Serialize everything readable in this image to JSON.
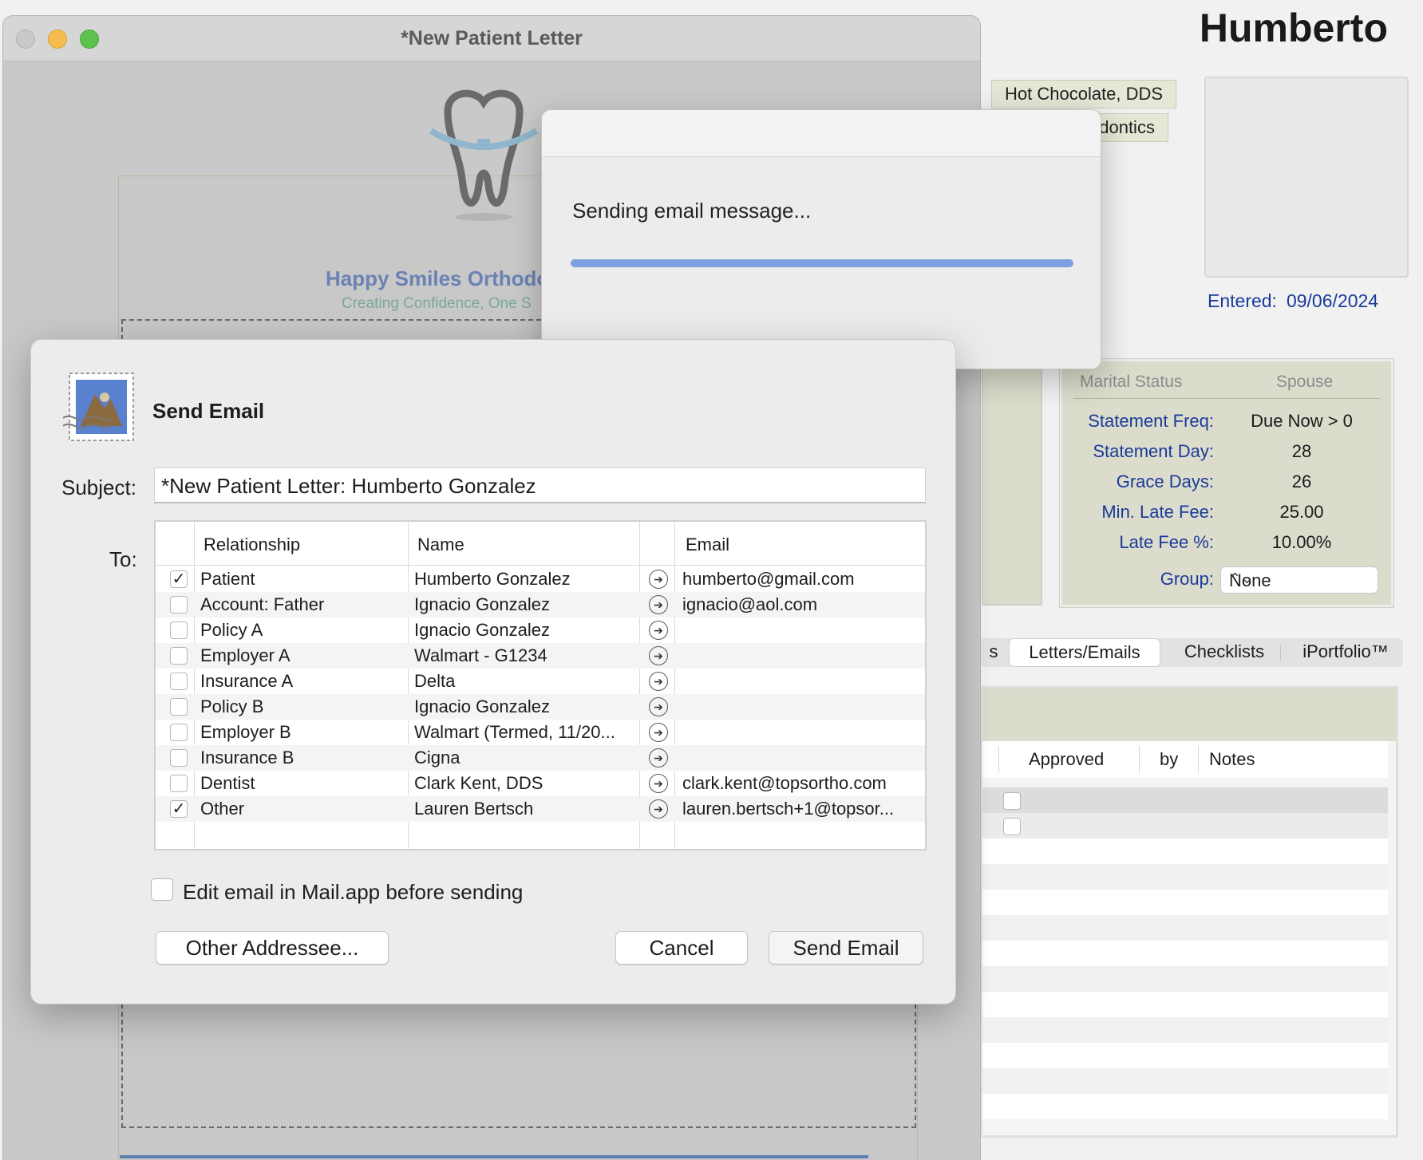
{
  "patient_window": {
    "patient_first_name": "Humberto",
    "doctor": "Hot Chocolate, DDS",
    "practice_type_partial": "odontics",
    "entered_label": "Entered:",
    "entered_date": "09/06/2024",
    "billing": {
      "marital_status_label": "Marital Status",
      "spouse_label": "Spouse",
      "rows": [
        {
          "label": "Statement Freq:",
          "value": "Due Now > 0"
        },
        {
          "label": "Statement Day:",
          "value": "28"
        },
        {
          "label": "Grace Days:",
          "value": "26"
        },
        {
          "label": "Min. Late Fee:",
          "value": "25.00"
        },
        {
          "label": "Late Fee %:",
          "value": "10.00%"
        }
      ],
      "group_label": "Group:",
      "group_value": "None"
    },
    "tabs": [
      {
        "label": "s"
      },
      {
        "label": "Letters/Emails",
        "active": true
      },
      {
        "label": "Checklists"
      },
      {
        "label": "iPortfolio™"
      }
    ],
    "list_columns": {
      "approved": "Approved",
      "by": "by",
      "notes": "Notes"
    }
  },
  "letter_window": {
    "title": "*New Patient Letter",
    "practice_name": "Happy Smiles Orthodo",
    "practice_tagline": "Creating Confidence, One S"
  },
  "progress_dialog": {
    "message": "Sending email message...",
    "progress": 1.0
  },
  "send_email": {
    "title": "Send Email",
    "subject_label": "Subject:",
    "subject_value": "*New Patient Letter: Humberto Gonzalez",
    "to_label": "To:",
    "columns": {
      "relationship": "Relationship",
      "name": "Name",
      "email": "Email"
    },
    "recipients": [
      {
        "checked": true,
        "relationship": "Patient",
        "name": "Humberto Gonzalez",
        "email": "humberto@gmail.com"
      },
      {
        "checked": false,
        "relationship": "Account: Father",
        "name": "Ignacio Gonzalez",
        "email": "ignacio@aol.com"
      },
      {
        "checked": false,
        "relationship": "Policy A",
        "name": "Ignacio Gonzalez",
        "email": ""
      },
      {
        "checked": false,
        "relationship": "Employer A",
        "name": "Walmart - G1234",
        "email": ""
      },
      {
        "checked": false,
        "relationship": "Insurance A",
        "name": "Delta",
        "email": ""
      },
      {
        "checked": false,
        "relationship": "Policy B",
        "name": "Ignacio Gonzalez",
        "email": ""
      },
      {
        "checked": false,
        "relationship": "Employer B",
        "name": "Walmart (Termed, 11/20...",
        "email": ""
      },
      {
        "checked": false,
        "relationship": "Insurance B",
        "name": "Cigna",
        "email": ""
      },
      {
        "checked": false,
        "relationship": "Dentist",
        "name": "Clark Kent, DDS",
        "email": "clark.kent@topsortho.com"
      },
      {
        "checked": true,
        "relationship": "Other",
        "name": "Lauren Bertsch",
        "email": "lauren.bertsch+1@topsor..."
      }
    ],
    "edit_in_mail_label": "Edit email in Mail.app before sending",
    "edit_in_mail_checked": false,
    "other_addressee_button": "Other Addressee...",
    "cancel_button": "Cancel",
    "send_button": "Send Email"
  },
  "colors": {
    "accent_blue": "#1a3a9a",
    "billing_panel": "#dcdccc",
    "progress_fill": "#7f9fe0",
    "traffic_close": "#c9c9c9",
    "traffic_min": "#f5bd4f",
    "traffic_max": "#5ec24f"
  },
  "icons": {
    "stamp": "mail-stamp-icon",
    "arrow": "arrow-circle-icon",
    "check": "checkmark-icon"
  }
}
